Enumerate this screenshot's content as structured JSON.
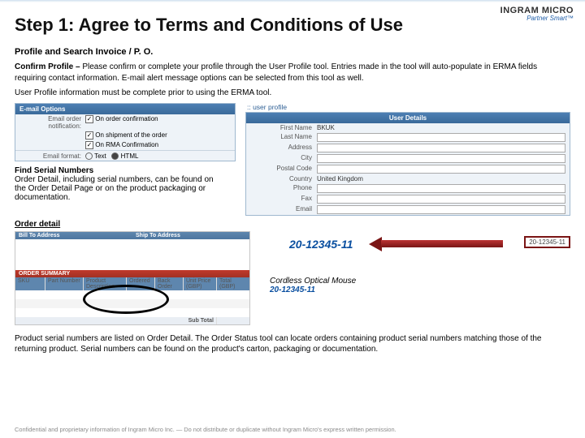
{
  "brand": {
    "line1a": "INGRAM",
    "line1b": "MICRO",
    "line2": "Partner Smart™"
  },
  "title": "Step 1: Agree to Terms and Conditions of Use",
  "subtitle": "Profile and Search Invoice / P. O.",
  "confirm_prefix": "Confirm Profile –",
  "confirm_text": " Please confirm or complete your profile through the User Profile tool. Entries made in the tool will auto-populate in ERMA fields requiring contact information. E-mail alert message options can be selected from this tool as well.",
  "mustcomplete": "User Profile information must be complete prior to using the ERMA tool.",
  "email_panel": {
    "header": "E-mail Options",
    "row_label": "Email order notification:",
    "opts": [
      "On order confirmation",
      "On shipment of the order",
      "On RMA Confirmation"
    ],
    "fmt_label": "Email format:",
    "fmt_opts": [
      "Text",
      "HTML"
    ]
  },
  "user_panel": {
    "crumb": ":: user profile",
    "header": "User Details",
    "fields": [
      "First Name",
      "Last Name",
      "Address",
      "City",
      "Postal Code",
      "Country",
      "Phone",
      "Fax",
      "Email"
    ],
    "country": "United Kingdom",
    "first": "BKUK"
  },
  "find": {
    "title": "Find Serial Numbers",
    "text": "Order Detail, including serial numbers, can be found on the Order Detail Page or on the product packaging or documentation."
  },
  "order_label": "Order detail",
  "order_detail": {
    "bill_hdr": "Bill To Address",
    "ship_hdr": "Ship To Address",
    "summary_hdr": "ORDER SUMMARY",
    "cols": [
      "SKU",
      "Part Number",
      "Product Description",
      "Ordered",
      "Back Order",
      "Unit Price (GBP)",
      "Total (GBP)"
    ],
    "subtotal": "Sub Total"
  },
  "serial": "20-12345-11",
  "box_label": "20-12345-11",
  "product_name": "Cordless Optical Mouse",
  "product_serial": "20-12345-11",
  "footnote": "Product serial numbers are listed on Order Detail. The Order Status tool can locate orders containing product serial numbers matching those of the returning product. Serial numbers can be found on the product's carton, packaging or documentation.",
  "confidential": "Confidential and proprietary information of Ingram Micro Inc. — Do not distribute or duplicate without Ingram Micro's express written permission."
}
